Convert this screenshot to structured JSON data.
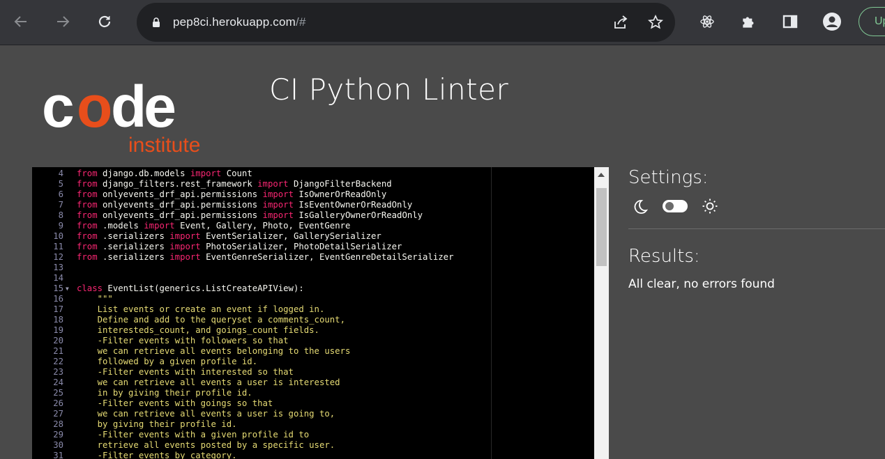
{
  "browser": {
    "url_host": "pep8ci.herokuapp.com",
    "url_rest": "/#",
    "update_label": "Up"
  },
  "page": {
    "logo_main": "code",
    "logo_sub": "institute",
    "title": "CI Python Linter"
  },
  "editor": {
    "lines": [
      {
        "n": "4",
        "segs": [
          [
            "from",
            "kw"
          ],
          [
            " django.db.models ",
            ""
          ],
          [
            "import",
            "kw"
          ],
          [
            " Count",
            ""
          ]
        ]
      },
      {
        "n": "5",
        "segs": [
          [
            "from",
            "kw"
          ],
          [
            " django_filters.rest_framework ",
            ""
          ],
          [
            "import",
            "kw"
          ],
          [
            " DjangoFilterBackend",
            ""
          ]
        ]
      },
      {
        "n": "6",
        "segs": [
          [
            "from",
            "kw"
          ],
          [
            " onlyevents_drf_api.permissions ",
            ""
          ],
          [
            "import",
            "kw"
          ],
          [
            " IsOwnerOrReadOnly",
            ""
          ]
        ]
      },
      {
        "n": "7",
        "segs": [
          [
            "from",
            "kw"
          ],
          [
            " onlyevents_drf_api.permissions ",
            ""
          ],
          [
            "import",
            "kw"
          ],
          [
            " IsEventOwnerOrReadOnly",
            ""
          ]
        ]
      },
      {
        "n": "8",
        "segs": [
          [
            "from",
            "kw"
          ],
          [
            " onlyevents_drf_api.permissions ",
            ""
          ],
          [
            "import",
            "kw"
          ],
          [
            " IsGalleryOwnerOrReadOnly",
            ""
          ]
        ]
      },
      {
        "n": "9",
        "segs": [
          [
            "from",
            "kw"
          ],
          [
            " .models ",
            ""
          ],
          [
            "import",
            "kw"
          ],
          [
            " Event, Gallery, Photo, EventGenre",
            ""
          ]
        ]
      },
      {
        "n": "10",
        "segs": [
          [
            "from",
            "kw"
          ],
          [
            " .serializers ",
            ""
          ],
          [
            "import",
            "kw"
          ],
          [
            " EventSerializer, GallerySerializer",
            ""
          ]
        ]
      },
      {
        "n": "11",
        "segs": [
          [
            "from",
            "kw"
          ],
          [
            " .serializers ",
            ""
          ],
          [
            "import",
            "kw"
          ],
          [
            " PhotoSerializer, PhotoDetailSerializer",
            ""
          ]
        ]
      },
      {
        "n": "12",
        "segs": [
          [
            "from",
            "kw"
          ],
          [
            " .serializers ",
            ""
          ],
          [
            "import",
            "kw"
          ],
          [
            " EventGenreSerializer, EventGenreDetailSerializer",
            ""
          ]
        ]
      },
      {
        "n": "13",
        "segs": []
      },
      {
        "n": "14",
        "segs": []
      },
      {
        "n": "15",
        "fold": true,
        "segs": [
          [
            "class",
            "kw"
          ],
          [
            " EventList(generics.ListCreateAPIView):",
            ""
          ]
        ]
      },
      {
        "n": "16",
        "segs": [
          [
            "    \"\"\"",
            "str"
          ]
        ]
      },
      {
        "n": "17",
        "segs": [
          [
            "    List events or create an event if logged in.",
            "str"
          ]
        ]
      },
      {
        "n": "18",
        "segs": [
          [
            "    Define and add to the queryset a comments_count,",
            "str"
          ]
        ]
      },
      {
        "n": "19",
        "segs": [
          [
            "    interesteds_count, and goings_count fields.",
            "str"
          ]
        ]
      },
      {
        "n": "20",
        "segs": [
          [
            "    -Filter events with followers so that",
            "str"
          ]
        ]
      },
      {
        "n": "21",
        "segs": [
          [
            "    we can retrieve all events belonging to the users",
            "str"
          ]
        ]
      },
      {
        "n": "22",
        "segs": [
          [
            "    followed by a given profile id.",
            "str"
          ]
        ]
      },
      {
        "n": "23",
        "segs": [
          [
            "    -Filter events with interested so that",
            "str"
          ]
        ]
      },
      {
        "n": "24",
        "segs": [
          [
            "    we can retrieve all events a user is interested",
            "str"
          ]
        ]
      },
      {
        "n": "25",
        "segs": [
          [
            "    in by giving their profile id.",
            "str"
          ]
        ]
      },
      {
        "n": "26",
        "segs": [
          [
            "    -Filter events with goings so that",
            "str"
          ]
        ]
      },
      {
        "n": "27",
        "segs": [
          [
            "    we can retrieve all events a user is going to,",
            "str"
          ]
        ]
      },
      {
        "n": "28",
        "segs": [
          [
            "    by giving their profile id.",
            "str"
          ]
        ]
      },
      {
        "n": "29",
        "segs": [
          [
            "    -Filter events with a given profile id to",
            "str"
          ]
        ]
      },
      {
        "n": "30",
        "segs": [
          [
            "    retrieve all events posted by a specific user.",
            "str"
          ]
        ]
      },
      {
        "n": "31",
        "segs": [
          [
            "    -Filter events by category.",
            "str"
          ]
        ]
      }
    ]
  },
  "settings": {
    "heading": "Settings:",
    "dark_icon": "moon-icon",
    "light_icon": "sun-icon"
  },
  "results": {
    "heading": "Results:",
    "message": "All clear, no errors found"
  },
  "colors": {
    "keyword": "#f92672",
    "string": "#e6db74",
    "logo_accent": "#e84e1b"
  }
}
